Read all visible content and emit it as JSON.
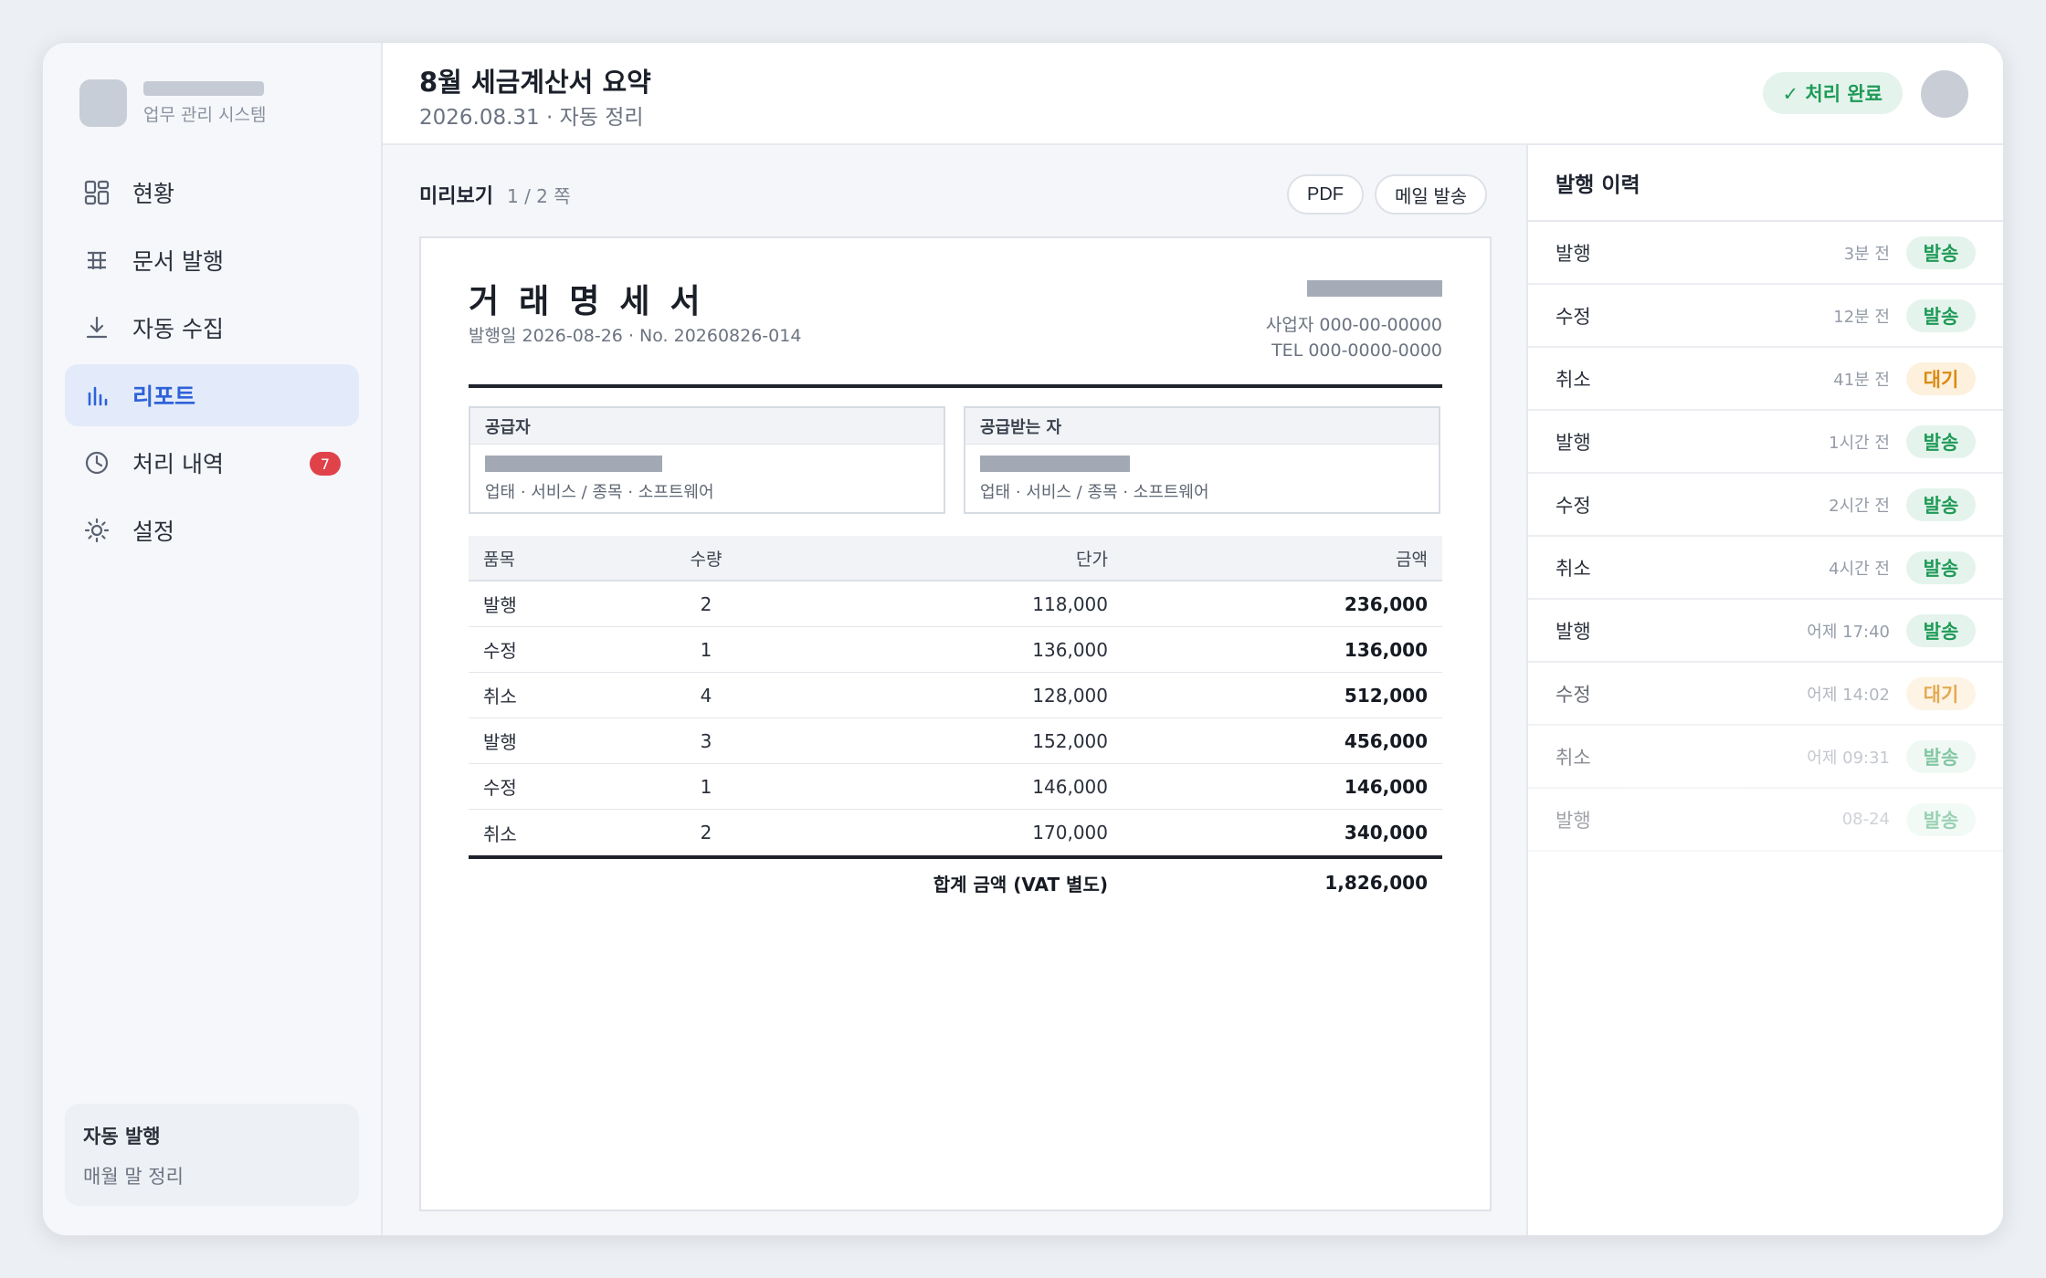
{
  "sidebar": {
    "brand_subtitle": "업무 관리 시스템",
    "items": [
      {
        "label": "현황",
        "icon": "dashboard-icon"
      },
      {
        "label": "문서 발행",
        "icon": "document-table-icon"
      },
      {
        "label": "자동 수집",
        "icon": "download-icon"
      },
      {
        "label": "리포트",
        "icon": "bar-chart-icon",
        "active": true
      },
      {
        "label": "처리 내역",
        "icon": "clock-icon",
        "badge": "7"
      },
      {
        "label": "설정",
        "icon": "gear-icon"
      }
    ],
    "auto_card": {
      "title": "자동 발행",
      "subtitle": "매월 말 정리"
    }
  },
  "header": {
    "title": "8월 세금계산서 요약",
    "subtitle": "2026.08.31 · 자동 정리",
    "status": "✓ 처리 완료"
  },
  "preview": {
    "title": "미리보기",
    "page": "1 / 2 쪽",
    "pdf_button": "PDF",
    "mail_button": "메일 발송"
  },
  "document": {
    "title": "거래명세서",
    "meta": "발행일 2026-08-26 · No. 20260826-014",
    "biz_no": "사업자 000-00-00000",
    "tel": "TEL 000-0000-0000",
    "supplier": {
      "heading": "공급자",
      "desc": "업태 · 서비스 / 종목 · 소프트웨어"
    },
    "receiver": {
      "heading": "공급받는 자",
      "desc": "업태 · 서비스 / 종목 · 소프트웨어"
    },
    "columns": {
      "item": "품목",
      "qty": "수량",
      "price": "단가",
      "amount": "금액"
    },
    "rows": [
      {
        "item": "발행",
        "qty": "2",
        "price": "118,000",
        "amount": "236,000"
      },
      {
        "item": "수정",
        "qty": "1",
        "price": "136,000",
        "amount": "136,000"
      },
      {
        "item": "취소",
        "qty": "4",
        "price": "128,000",
        "amount": "512,000"
      },
      {
        "item": "발행",
        "qty": "3",
        "price": "152,000",
        "amount": "456,000"
      },
      {
        "item": "수정",
        "qty": "1",
        "price": "146,000",
        "amount": "146,000"
      },
      {
        "item": "취소",
        "qty": "2",
        "price": "170,000",
        "amount": "340,000"
      }
    ],
    "total_label": "합계 금액 (VAT 별도)",
    "total_value": "1,826,000"
  },
  "history": {
    "title": "발행 이력",
    "items": [
      {
        "label": "발행",
        "time": "3분 전",
        "status": "발송"
      },
      {
        "label": "수정",
        "time": "12분 전",
        "status": "발송"
      },
      {
        "label": "취소",
        "time": "41분 전",
        "status": "대기"
      },
      {
        "label": "발행",
        "time": "1시간 전",
        "status": "발송"
      },
      {
        "label": "수정",
        "time": "2시간 전",
        "status": "발송"
      },
      {
        "label": "취소",
        "time": "4시간 전",
        "status": "발송"
      },
      {
        "label": "발행",
        "time": "어제 17:40",
        "status": "발송"
      },
      {
        "label": "수정",
        "time": "어제 14:02",
        "status": "대기"
      },
      {
        "label": "취소",
        "time": "어제 09:31",
        "status": "발송"
      },
      {
        "label": "발행",
        "time": "08-24",
        "status": "발송"
      }
    ]
  },
  "colors": {
    "accent": "#2f62d9",
    "sent": "#1f9a57",
    "waiting": "#d98a12",
    "badge": "#e0424a"
  }
}
